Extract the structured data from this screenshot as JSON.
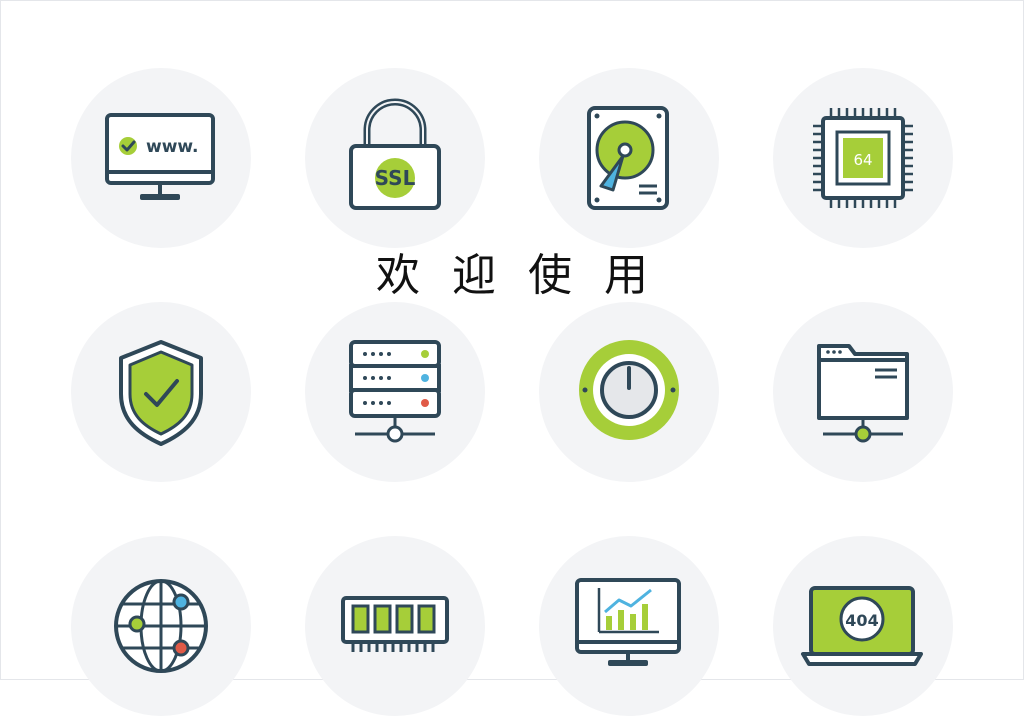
{
  "welcome_title": "欢迎使用",
  "colors": {
    "stroke": "#2f4858",
    "accent": "#a6ce39",
    "tile_bg": "#f3f4f6",
    "blue_dot": "#4fb3e0",
    "red_dot": "#e05a47"
  },
  "tiles": [
    {
      "icon": "www-monitor-icon",
      "text": "www."
    },
    {
      "icon": "ssl-lock-icon",
      "text": "SSL"
    },
    {
      "icon": "hard-drive-icon"
    },
    {
      "icon": "cpu-chip-icon",
      "text": "64"
    },
    {
      "icon": "shield-check-icon"
    },
    {
      "icon": "server-rack-icon"
    },
    {
      "icon": "power-button-icon"
    },
    {
      "icon": "network-folder-icon"
    },
    {
      "icon": "globe-network-icon"
    },
    {
      "icon": "ram-memory-icon"
    },
    {
      "icon": "analytics-monitor-icon"
    },
    {
      "icon": "laptop-404-icon",
      "text": "404"
    }
  ]
}
